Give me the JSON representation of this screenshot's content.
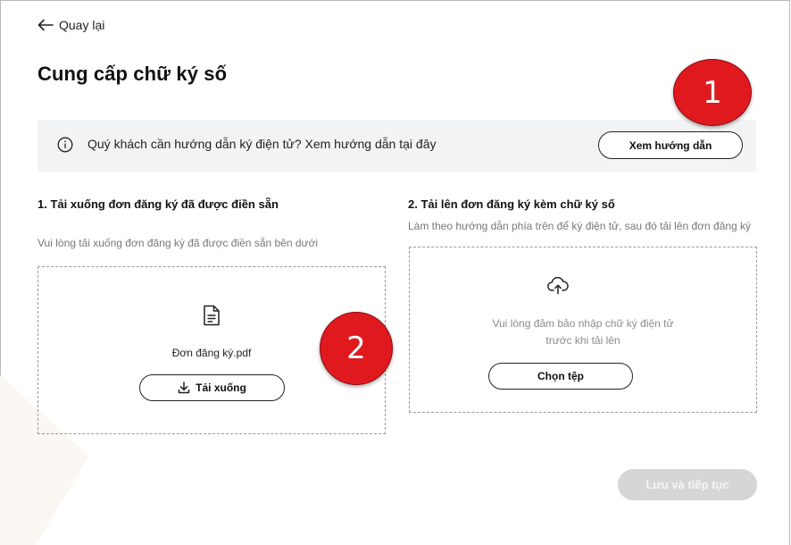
{
  "nav": {
    "back_label": "Quay lại"
  },
  "page": {
    "title": "Cung cấp chữ ký số"
  },
  "banner": {
    "icon": "info-icon",
    "text": "Quý khách cần hướng dẫn ký điện tử? Xem hướng dẫn tại đây",
    "button_label": "Xem hướng dẫn"
  },
  "markers": {
    "first": "1",
    "second": "2"
  },
  "download_section": {
    "title": "1.  Tải xuống đơn đăng ký đã được điền sẵn",
    "subtitle": "Vui lòng tải xuống đơn đăng ký đã được điền sẵn bên dưới",
    "file_icon": "document-icon",
    "file_name": "Đơn đăng ký.pdf",
    "button_icon": "download-icon",
    "button_label": "Tải xuống"
  },
  "upload_section": {
    "title": "2. Tải lên đơn đăng ký kèm chữ ký số",
    "subtitle": "Làm theo hướng dẫn phía trên để ký điện tử, sau đó tải lên đơn đăng ký",
    "icon": "cloud-upload-icon",
    "note_line1": "Vui lòng đảm bảo nhập chữ ký điện tử",
    "note_line2": "trước khi tải lên",
    "button_label": "Chọn tệp"
  },
  "footer": {
    "save_label": "Lưu và tiếp tục",
    "save_enabled": false
  },
  "colors": {
    "marker": "#e0191f",
    "banner_bg": "#f2f3f5",
    "disabled_button": "#d6d6d6"
  }
}
